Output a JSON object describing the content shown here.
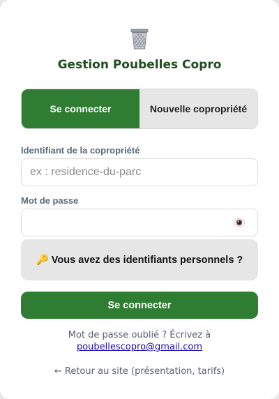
{
  "header": {
    "logo_icon": "wastebasket-icon",
    "title": "Gestion Poubelles Copro"
  },
  "tabs": {
    "login_label": "Se connecter",
    "new_label": "Nouvelle copropriété"
  },
  "form": {
    "identifier_label": "Identifiant de la copropriété",
    "identifier_placeholder": "ex : residence-du-parc",
    "identifier_value": "",
    "password_label": "Mot de passe",
    "password_value": "",
    "show_password_icon": "eye-icon",
    "personal_credentials_label": "🔑 Vous avez des identifiants personnels ?",
    "submit_label": "Se connecter"
  },
  "footer": {
    "forgot_text": "Mot de passe oublié ? Écrivez à",
    "forgot_email": "poubellescopro@gmail.com",
    "back_link": "← Retour au site (présentation, tarifs)"
  },
  "colors": {
    "accent": "#2f7d32",
    "title": "#1f4d1f",
    "inactive_tab": "#e6e6e6"
  }
}
